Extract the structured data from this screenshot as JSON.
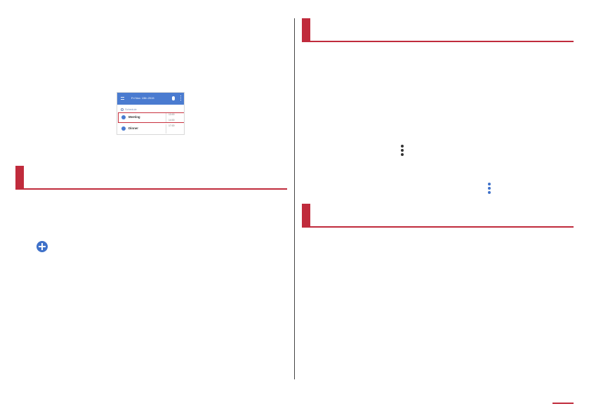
{
  "screenshot": {
    "date": "Fri Nov. 13th 2015",
    "section_label": "Schedule",
    "events": [
      {
        "title": "Meeting",
        "time_start": "13:00",
        "time_end": "14:00"
      },
      {
        "title": "Dinner",
        "time_start": "17:00",
        "time_end": ""
      }
    ],
    "highlighted_event": "Meeting"
  },
  "headings": {
    "left": "",
    "right_top": "",
    "right_bottom": ""
  },
  "icons": {
    "add": "plus-circle-icon",
    "more": "more-vert-icon"
  },
  "colors": {
    "accent_red": "#c02b3c",
    "app_blue": "#4a7bd0"
  }
}
